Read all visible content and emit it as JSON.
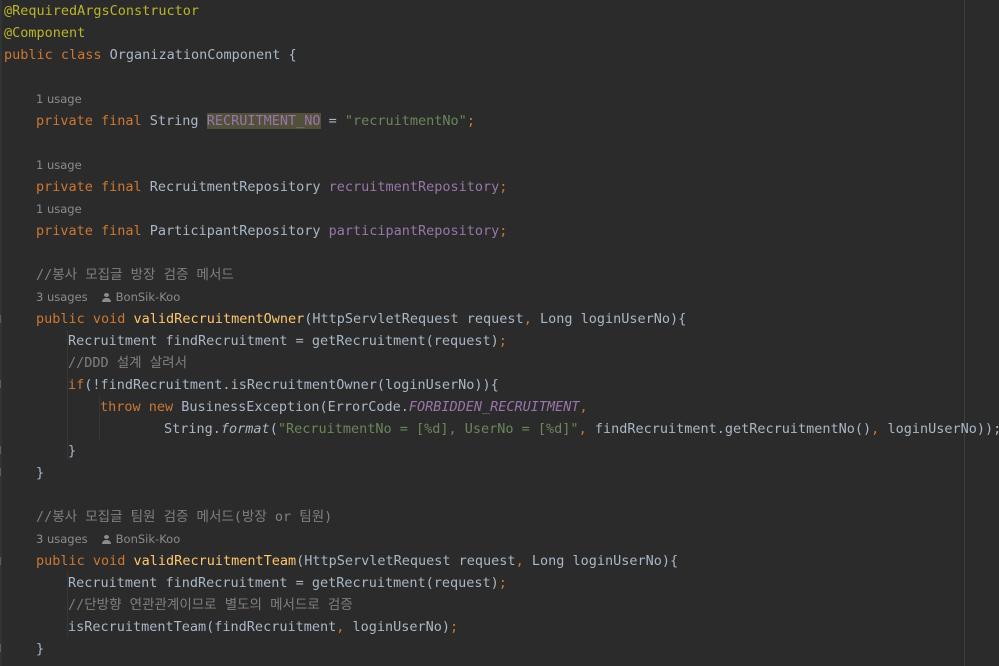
{
  "code": {
    "ann1": "@RequiredArgsConstructor",
    "ann2": "@Component",
    "class_kw": "public class ",
    "class_name": "OrganizationComponent {",
    "usage1": "1 usage",
    "f1_kw": "private final ",
    "f1_type": "String ",
    "f1_name": "RECRUITMENT_NO",
    "f1_eq": " = ",
    "f1_val": "\"recruitmentNo\"",
    "semi": ";",
    "usage2": "1 usage",
    "f2_kw": "private final ",
    "f2_type": "RecruitmentRepository ",
    "f2_name": "recruitmentRepository",
    "usage3": "1 usage",
    "f3_kw": "private final ",
    "f3_type": "ParticipantRepository ",
    "f3_name": "participantRepository",
    "comment1": "//봉사 모집글 방장 검증 메서드",
    "usages4": "3 usages",
    "author4": "BonSik-Koo",
    "m1_kw": "public void ",
    "m1_name": "validRecruitmentOwner",
    "m1_params_a": "(HttpServletRequest request",
    "comma": ", ",
    "m1_params_b": "Long loginUserNo){",
    "m1_l1_a": "Recruitment findRecruitment = getRecruitment(request)",
    "m1_comment": "//DDD 설계 살려서",
    "m1_if_kw": "if",
    "m1_if_rest": "(!findRecruitment.isRecruitmentOwner(loginUserNo)){",
    "m1_throw_kw": "throw new ",
    "m1_throw_a": "BusinessException(ErrorCode.",
    "m1_throw_const": "FORBIDDEN_RECRUITMENT",
    "m1_fmt_a": "String.",
    "m1_fmt_fn": "format",
    "m1_fmt_b": "(",
    "m1_fmt_str": "\"RecruitmentNo = [%d], UserNo = [%d]\"",
    "m1_fmt_c": "findRecruitment.getRecruitmentNo()",
    "m1_fmt_d": "loginUserNo));",
    "close_brace": "}",
    "comment2": "//봉사 모집글 팀원 검증 메서드(방장 or 팀원)",
    "usages5": "3 usages",
    "author5": "BonSik-Koo",
    "m2_kw": "public void ",
    "m2_name": "validRecruitmentTeam",
    "m2_params_a": "(HttpServletRequest request",
    "m2_params_b": "Long loginUserNo){",
    "m2_l1_a": "Recruitment findRecruitment = getRecruitment(request)",
    "m2_comment": "//단방향 연관관계이므로 별도의 메서드로 검증",
    "m2_call_a": "isRecruitmentTeam(findRecruitment",
    "m2_call_b": "loginUserNo)"
  }
}
